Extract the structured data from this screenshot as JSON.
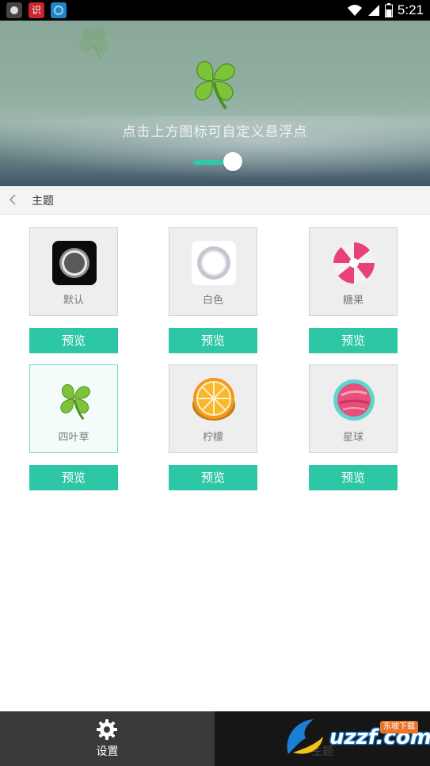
{
  "status_bar": {
    "time": "5:21",
    "left_icons": [
      "record-icon",
      "recognize-app-icon",
      "browser-app-icon"
    ],
    "right_icons": [
      "wifi-icon",
      "signal-icon",
      "battery-icon"
    ]
  },
  "banner": {
    "hint": "点击上方图标可自定义悬浮点",
    "toggle_on": true
  },
  "titlebar": {
    "title": "主题"
  },
  "themes": [
    {
      "id": "default",
      "label": "默认",
      "icon": "black-ring-icon",
      "selected": false,
      "preview_label": "预览"
    },
    {
      "id": "white",
      "label": "白色",
      "icon": "white-ring-icon",
      "selected": false,
      "preview_label": "预览"
    },
    {
      "id": "candy",
      "label": "糖果",
      "icon": "candy-icon",
      "selected": false,
      "preview_label": "预览"
    },
    {
      "id": "clover",
      "label": "四叶草",
      "icon": "clover-icon",
      "selected": true,
      "preview_label": "预览"
    },
    {
      "id": "lemon",
      "label": "柠檬",
      "icon": "lemon-icon",
      "selected": false,
      "preview_label": "预览"
    },
    {
      "id": "planet",
      "label": "星球",
      "icon": "planet-icon",
      "selected": false,
      "preview_label": "预览"
    }
  ],
  "bottom_nav": {
    "settings_label": "设置",
    "theme_label": "主题"
  },
  "watermark": {
    "text": "uzzf.com",
    "badge": "东坡下载"
  },
  "colors": {
    "accent": "#2ec7a6",
    "bottom_active": "#3a3a3a",
    "bottom_inactive": "#161616"
  }
}
